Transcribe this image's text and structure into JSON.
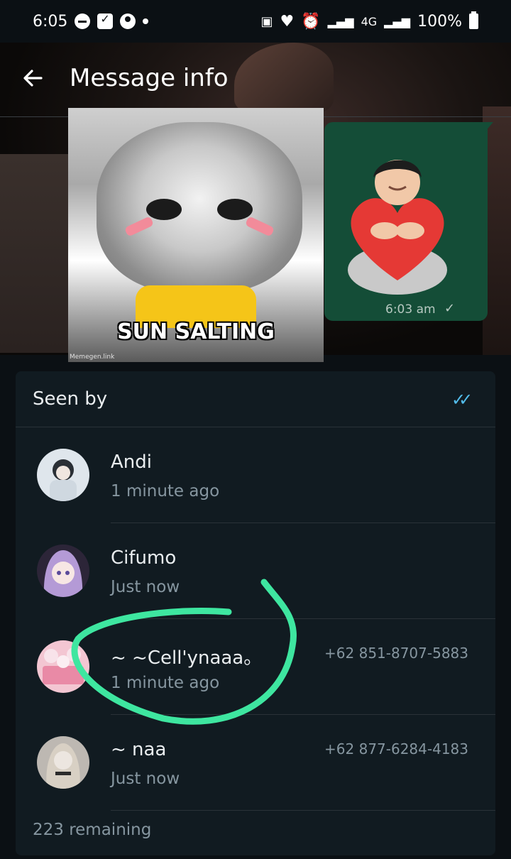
{
  "status_bar": {
    "time": "6:05",
    "network": "4G",
    "battery": "100%"
  },
  "header": {
    "title": "Message info",
    "back_icon": "arrow-left-icon"
  },
  "messages": {
    "meme_caption": "SUN SALTING",
    "meme_watermark": "Memegen.link",
    "sticker_time": "6:03 am"
  },
  "seen_by": {
    "title": "Seen by",
    "readers": [
      {
        "name": "Andi",
        "time": "1 minute ago",
        "phone": ""
      },
      {
        "name": "Cifumo",
        "time": "Just now",
        "phone": ""
      },
      {
        "name": "~ ~Cell'ynaaa。",
        "time": "1 minute ago",
        "phone": "+62 851-8707-5883"
      },
      {
        "name": "~ naa",
        "time": "Just now",
        "phone": "+62 877-6284-4183"
      }
    ],
    "remaining": "223 remaining"
  },
  "colors": {
    "panel_bg": "#111b21",
    "bubble_bg": "#144d37",
    "read_tick": "#53bdeb",
    "annotation": "#3ee6a0"
  }
}
